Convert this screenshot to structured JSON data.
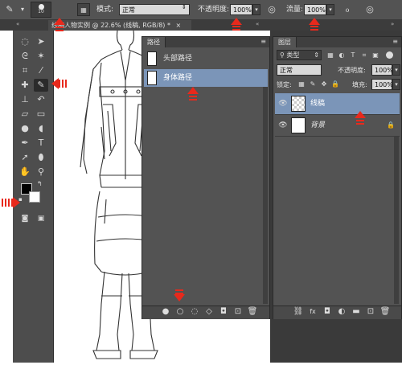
{
  "options_bar": {
    "brush_size": "10",
    "mode_label": "模式:",
    "mode_value": "正常",
    "opacity_label": "不透明度:",
    "opacity_value": "100%",
    "flow_label": "流量:",
    "flow_value": "100%"
  },
  "document": {
    "tab_title": "线稿人物实例 @ 22.6% (线稿, RGB/8) *",
    "close_glyph": "×"
  },
  "paths_panel": {
    "title": "路径",
    "paths": [
      {
        "name": "头部路径",
        "selected": false
      },
      {
        "name": "身体路径",
        "selected": true
      }
    ]
  },
  "layers_panel": {
    "title": "图层",
    "filter_label": "类型",
    "blend_mode": "正常",
    "opacity_label": "不透明度:",
    "opacity_value": "100%",
    "lock_label": "锁定:",
    "fill_label": "填充:",
    "fill_value": "100%",
    "layers": [
      {
        "name": "线稿",
        "selected": true,
        "visible": true
      },
      {
        "name": "背景",
        "selected": false,
        "visible": true,
        "locked": true
      }
    ]
  },
  "colors": {
    "accent_selected": "#7b95b8",
    "annotation_arrow": "#e8291c",
    "foreground_swatch": "#000000",
    "background_swatch": "#ffffff"
  }
}
